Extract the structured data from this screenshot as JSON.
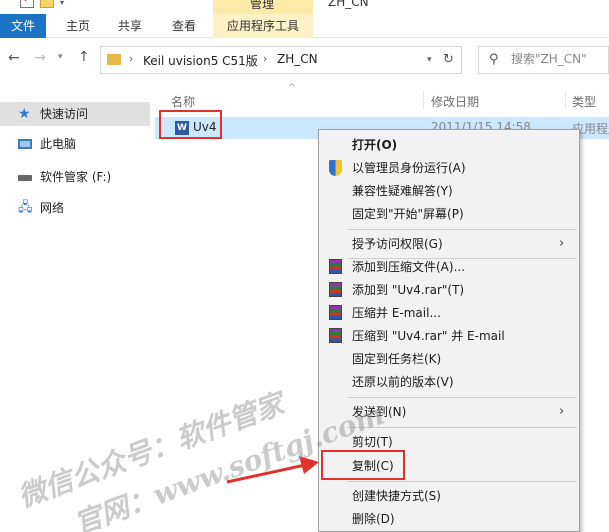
{
  "titlebar": {
    "manage_label": "管理",
    "window_title": "ZH_CN"
  },
  "ribbon": {
    "tabs": [
      {
        "label": "文件",
        "active": true
      },
      {
        "label": "主页"
      },
      {
        "label": "共享"
      },
      {
        "label": "查看"
      },
      {
        "label": "应用程序工具"
      }
    ]
  },
  "address": {
    "segments": [
      "Keil uvision5 C51版",
      "ZH_CN"
    ],
    "separator": "›"
  },
  "search": {
    "placeholder": "搜索\"ZH_CN\""
  },
  "navpane": {
    "items": [
      {
        "label": "快速访问",
        "icon": "star-icon",
        "selected": true
      },
      {
        "label": "此电脑",
        "icon": "pc-icon"
      },
      {
        "label": "软件管家 (F:)",
        "icon": "drive-icon"
      },
      {
        "label": "网络",
        "icon": "network-icon"
      }
    ]
  },
  "filelist": {
    "columns": [
      "名称",
      "修改日期",
      "类型"
    ],
    "rows": [
      {
        "name": "Uv4",
        "date": "2011/1/15 14:58",
        "type": "应用程序"
      }
    ]
  },
  "context_menu": {
    "items": [
      {
        "label": "打开(O)",
        "bold": true
      },
      {
        "label": "以管理员身份运行(A)",
        "icon": "shield-icon"
      },
      {
        "label": "兼容性疑难解答(Y)"
      },
      {
        "label": "固定到\"开始\"屏幕(P)"
      },
      {
        "label": "授予访问权限(G)",
        "submenu": true
      },
      {
        "label": "添加到压缩文件(A)...",
        "icon": "winrar-icon"
      },
      {
        "label": "添加到 \"Uv4.rar\"(T)",
        "icon": "winrar-icon"
      },
      {
        "label": "压缩并 E-mail...",
        "icon": "winrar-icon"
      },
      {
        "label": "压缩到 \"Uv4.rar\" 并 E-mail",
        "icon": "winrar-icon"
      },
      {
        "label": "固定到任务栏(K)"
      },
      {
        "label": "还原以前的版本(V)"
      },
      {
        "label": "发送到(N)",
        "submenu": true
      },
      {
        "label": "剪切(T)"
      },
      {
        "label": "复制(C)",
        "highlighted": true
      },
      {
        "label": "创建快捷方式(S)"
      },
      {
        "label": "删除(D)"
      }
    ]
  },
  "watermark": {
    "line1": "微信公众号：软件管家",
    "line2": "官网：www.softgj.com"
  },
  "colors": {
    "file_tab": "#1a73c4",
    "selection": "#cce8ff",
    "annotation_red": "#e0322d",
    "manage_tab": "#fbeaa8"
  }
}
